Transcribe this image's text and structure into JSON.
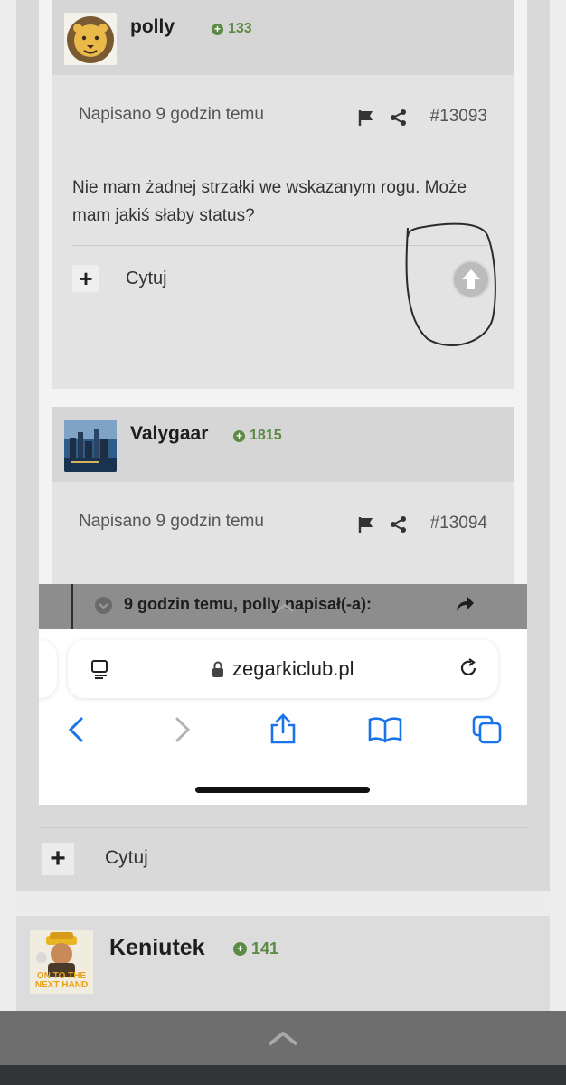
{
  "posts": [
    {
      "username": "polly",
      "reputation": "133",
      "timestamp": "Napisano 9 godzin temu",
      "post_number": "#13093",
      "text": "Nie mam żadnej strzałki we wskazanym rogu. Może mam jakiś słaby status?",
      "quote_label": "Cytuj"
    },
    {
      "username": "Valygaar",
      "reputation": "1815",
      "timestamp": "Napisano 9 godzin temu",
      "post_number": "#13094",
      "quote_header": "9 godzin temu, polly napisał(-a):"
    }
  ],
  "browser": {
    "url": "zegarkiclub.pl"
  },
  "outer": {
    "quote_label": "Cytuj",
    "next_user": {
      "username": "Keniutek",
      "reputation": "141",
      "avatar_text": "ON TO THE NEXT HAND"
    }
  }
}
